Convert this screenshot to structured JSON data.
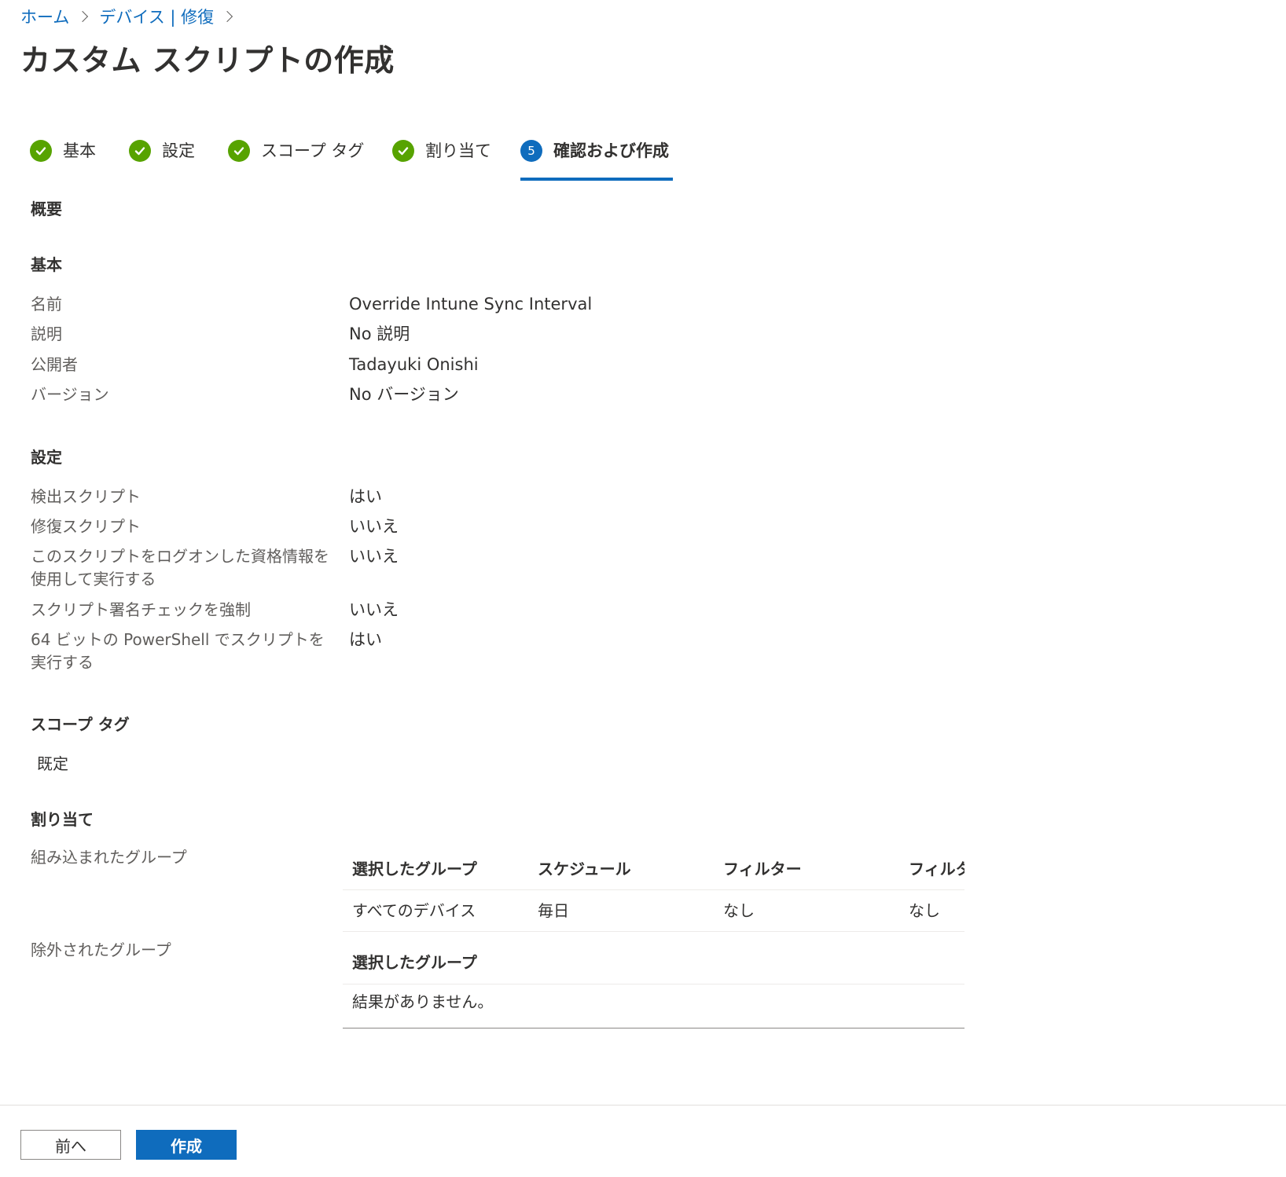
{
  "breadcrumb": {
    "home": "ホーム",
    "parent": "デバイス | 修復"
  },
  "title": "カスタム スクリプトの作成",
  "more": "…",
  "steps": [
    {
      "label": "基本",
      "state": "done"
    },
    {
      "label": "設定",
      "state": "done"
    },
    {
      "label": "スコープ タグ",
      "state": "done"
    },
    {
      "label": "割り当て",
      "state": "done"
    },
    {
      "label": "確認および作成",
      "state": "current",
      "number": "5"
    }
  ],
  "summary": "概要",
  "basics": {
    "heading": "基本",
    "rows": [
      {
        "label": "名前",
        "value": "Override Intune Sync Interval"
      },
      {
        "label": "説明",
        "value": "No 説明"
      },
      {
        "label": "公開者",
        "value": "Tadayuki Onishi"
      },
      {
        "label": "バージョン",
        "value": "No バージョン"
      }
    ]
  },
  "settings": {
    "heading": "設定",
    "rows": [
      {
        "label": "検出スクリプト",
        "value": "はい"
      },
      {
        "label": "修復スクリプト",
        "value": "いいえ"
      },
      {
        "label": "このスクリプトをログオンした資格情報を使用して実行する",
        "value": "いいえ"
      },
      {
        "label": "スクリプト署名チェックを強制",
        "value": "いいえ"
      },
      {
        "label": "64 ビットの PowerShell でスクリプトを実行する",
        "value": "はい"
      }
    ]
  },
  "scope_tags": {
    "heading": "スコープ タグ",
    "value": "既定"
  },
  "assignments": {
    "heading": "割り当て",
    "included": {
      "label": "組み込まれたグループ",
      "columns": [
        "選択したグループ",
        "スケジュール",
        "フィルター",
        "フィルタ"
      ],
      "rows": [
        [
          "すべてのデバイス",
          "毎日",
          "なし",
          "なし"
        ]
      ]
    },
    "excluded": {
      "label": "除外されたグループ",
      "columns": [
        "選択したグループ"
      ],
      "empty": "結果がありません。"
    }
  },
  "footer": {
    "previous": "前へ",
    "create": "作成"
  },
  "colors": {
    "accent": "#0f6cbd",
    "success": "#57a300"
  }
}
